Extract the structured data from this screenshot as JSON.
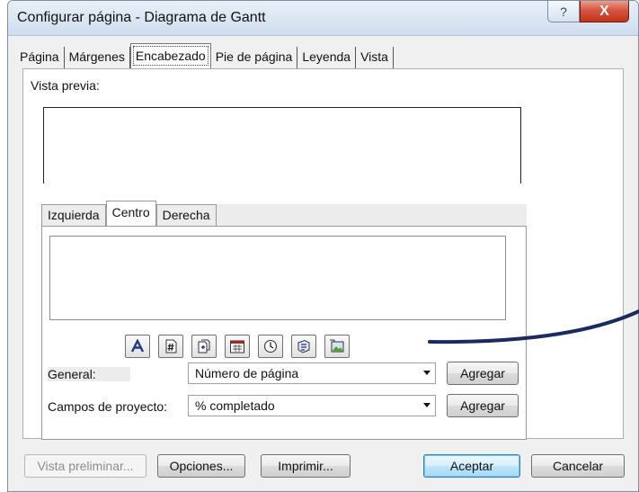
{
  "window": {
    "title": "Configurar página - Diagrama de Gantt",
    "help_glyph": "?",
    "close_glyph": "X"
  },
  "tabs": [
    {
      "label": "Página"
    },
    {
      "label": "Márgenes"
    },
    {
      "label": "Encabezado"
    },
    {
      "label": "Pie de página"
    },
    {
      "label": "Leyenda"
    },
    {
      "label": "Vista"
    }
  ],
  "active_tab": "Encabezado",
  "preview": {
    "label": "Vista previa:"
  },
  "alignment_tabs": [
    {
      "label": "Izquierda"
    },
    {
      "label": "Centro"
    },
    {
      "label": "Derecha"
    }
  ],
  "active_alignment_tab": "Centro",
  "toolbar": {
    "icons": [
      "format-text-font-icon",
      "insert-page-number-icon",
      "insert-total-pages-icon",
      "insert-current-date-icon",
      "insert-current-time-icon",
      "insert-file-name-icon",
      "insert-picture-icon"
    ]
  },
  "fields": {
    "general_label": "General:",
    "general_value": "Número de página",
    "campos_label": "Campos de proyecto:",
    "campos_value": "% completado",
    "add_label_1": "Agregar",
    "add_label_2": "Agregar"
  },
  "buttons": {
    "preview": "Vista preliminar...",
    "options": "Opciones...",
    "print": "Imprimir...",
    "accept": "Aceptar",
    "cancel": "Cancelar"
  },
  "colors": {
    "default_button_border": "#3c7fb1",
    "close_button": "#c2321d",
    "annotation_line": "#1c2a5e"
  }
}
